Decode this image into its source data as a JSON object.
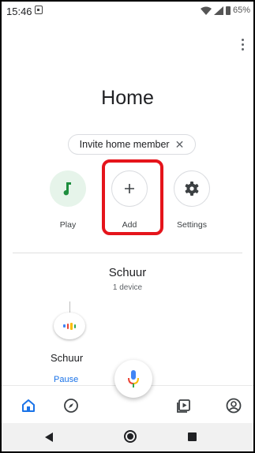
{
  "status_bar": {
    "time": "15:46",
    "battery": "65%"
  },
  "page": {
    "title": "Home"
  },
  "invite_chip": {
    "label": "Invite home member",
    "close_symbol": "✕"
  },
  "actions": [
    {
      "label": "Play",
      "icon": "music-note-icon"
    },
    {
      "label": "Add",
      "icon": "plus-icon"
    },
    {
      "label": "Settings",
      "icon": "gear-icon"
    }
  ],
  "room": {
    "name": "Schuur",
    "device_count": "1 device"
  },
  "device": {
    "name": "Schuur",
    "action": "Pause",
    "icon": "google-home-mini-icon"
  },
  "bottom_nav": [
    "home-icon",
    "discover-icon",
    "media-icon",
    "account-icon"
  ],
  "colors": {
    "accent_blue": "#1a73e8",
    "play_green": "#1e8e3e",
    "highlight_red": "#e5141b"
  }
}
